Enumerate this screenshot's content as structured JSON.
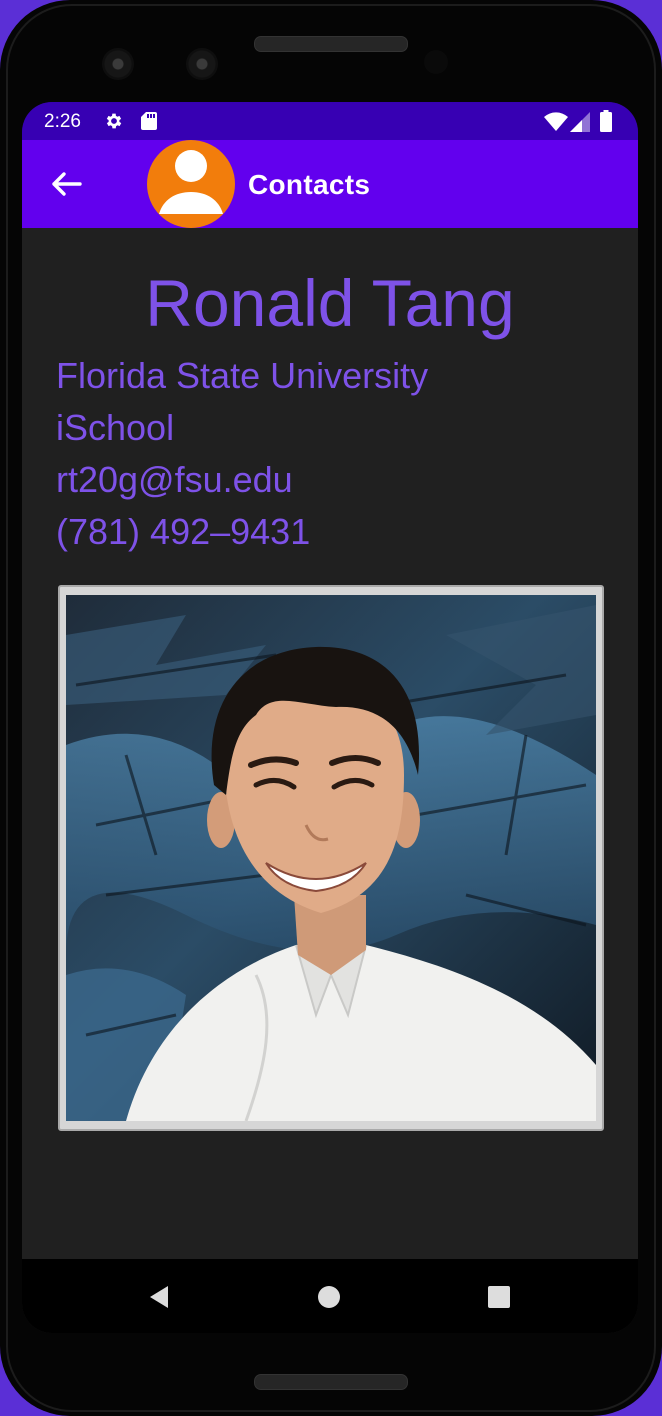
{
  "status_bar": {
    "time": "2:26",
    "icons": [
      "gear-icon",
      "sd-card-icon",
      "wifi-icon",
      "signal-icon",
      "battery-icon"
    ]
  },
  "app_bar": {
    "title": "Contacts",
    "back_icon": "arrow-back-icon",
    "avatar_icon": "person-avatar-icon"
  },
  "contact": {
    "name": "Ronald Tang",
    "organization": "Florida State University",
    "department": "iSchool",
    "email": "rt20g@fsu.edu",
    "phone": "(781) 492–9431",
    "photo_icon": "contact-photo"
  },
  "nav_bar": {
    "icons": [
      "nav-back-icon",
      "nav-home-icon",
      "nav-recents-icon"
    ]
  },
  "colors": {
    "status_bar": "#3700b3",
    "app_bar": "#6200ee",
    "accent_text": "#7e52e8",
    "avatar_bg": "#f27d0c",
    "background": "#202020"
  }
}
